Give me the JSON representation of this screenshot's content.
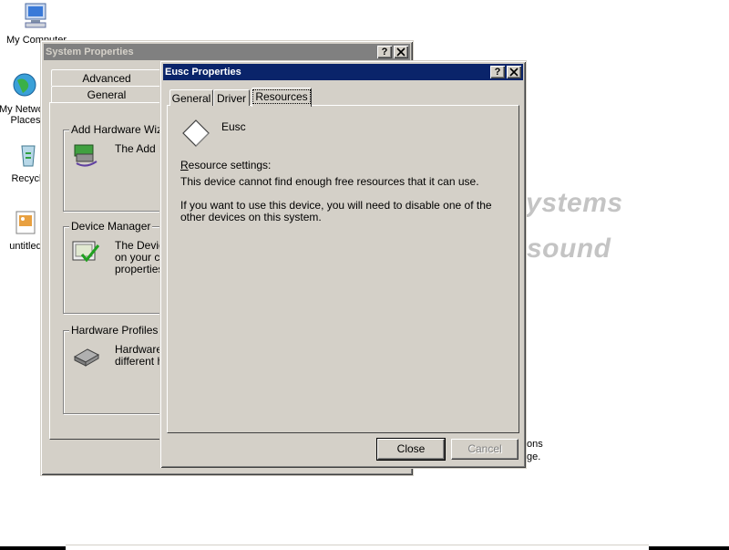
{
  "desktop": {
    "icons": [
      {
        "label": "My Computer"
      },
      {
        "label": "My Network Places"
      },
      {
        "label": "Recycle"
      },
      {
        "label": "untitled"
      }
    ],
    "background_text": [
      "systems",
      "sound"
    ],
    "background_small": [
      "ons",
      "ge."
    ]
  },
  "system_properties": {
    "title": "System Properties",
    "help_btn": "?",
    "close_btn": "✕",
    "tabs": [
      {
        "label": "Advanced"
      },
      {
        "label": "General"
      }
    ],
    "groups": [
      {
        "label": "Add Hardware Wizard",
        "text": "The Add H"
      },
      {
        "label": "Device Manager",
        "text_lines": [
          "The Devic",
          "on your co",
          "properties"
        ]
      },
      {
        "label": "Hardware Profiles",
        "text_lines": [
          "Hardware",
          "different h"
        ]
      }
    ]
  },
  "eusc_properties": {
    "title": "Eusc Properties",
    "help_btn": "?",
    "close_btn": "✕",
    "tabs": [
      {
        "label": "General"
      },
      {
        "label": "Driver"
      },
      {
        "label": "Resources",
        "active": true
      }
    ],
    "device_name": "Eusc",
    "device_icon": "diamond-icon",
    "resource_heading_accel": "R",
    "resource_heading_rest": "esource settings:",
    "resource_message": "This device cannot find enough free resources that it can use.",
    "disable_line1": "If you want to use this device, you will need to disable one of the",
    "disable_line2": "other devices on this system.",
    "buttons": {
      "close": "Close",
      "cancel": "Cancel"
    }
  }
}
